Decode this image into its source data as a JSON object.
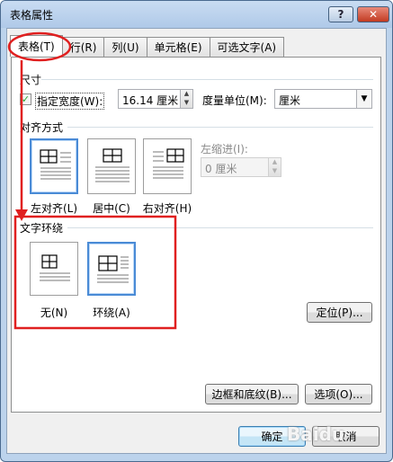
{
  "window": {
    "title": "表格属性",
    "help_label": "?",
    "close_label": "✕"
  },
  "tabs": [
    {
      "label": "表格(T)"
    },
    {
      "label": "行(R)"
    },
    {
      "label": "列(U)"
    },
    {
      "label": "单元格(E)"
    },
    {
      "label": "可选文字(A)"
    }
  ],
  "size_group": {
    "title": "尺寸",
    "checkbox_checked": true,
    "checkbox_label": "指定宽度(W):",
    "width_value": "16.14 厘米",
    "unit_label": "度量单位(M):",
    "unit_value": "厘米"
  },
  "alignment_group": {
    "title": "对齐方式",
    "options": [
      {
        "label": "左对齐(L)",
        "selected": true
      },
      {
        "label": "居中(C)",
        "selected": false
      },
      {
        "label": "右对齐(H)",
        "selected": false
      }
    ],
    "indent_label": "左缩进(I):",
    "indent_value": "0 厘米"
  },
  "wrap_group": {
    "title": "文字环绕",
    "options": [
      {
        "label": "无(N)",
        "selected": false
      },
      {
        "label": "环绕(A)",
        "selected": true
      }
    ]
  },
  "buttons": {
    "position": "定位(P)...",
    "borders": "边框和底纹(B)...",
    "options": "选项(O)...",
    "ok": "确定",
    "cancel": "取消"
  },
  "annotation_color": "#e02020",
  "watermark": "Baidu"
}
